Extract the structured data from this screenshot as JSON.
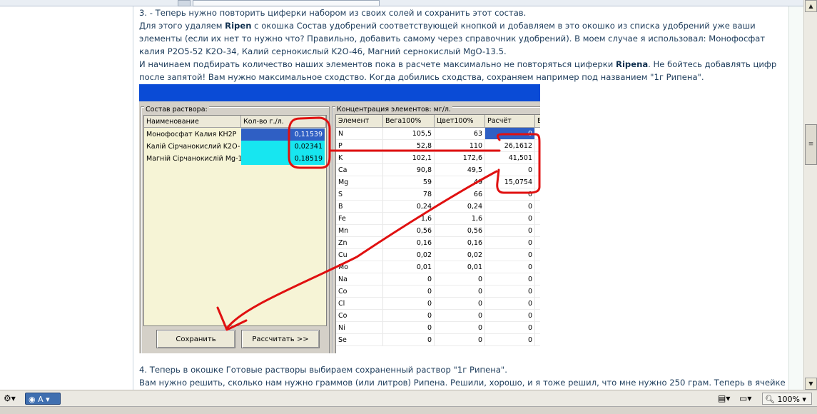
{
  "article": {
    "lines": [
      "3. - Теперь нужно повторить циферки набором из своих солей и сохранить этот состав.",
      [
        "Для этого удаляем ",
        "Ripen",
        " с окошка Состав удобрений соответствующей кнопкой и добавляем в это окошко из списка удобрений уже ваши"
      ],
      "элементы (если их нет то нужно что? Правильно, добавить самому через справочник удобрений). В моем случае я использовал: Монофосфат",
      "калия P2O5-52 K2O-34, Калий сернокислый K2O-46, Магний сернокислый MgO-13.5.",
      [
        "И начинаем подбирать количество наших элементов пока в расчете максимально не повторяться циферки ",
        "Ripena",
        ". Не бойтесь добавлять цифр"
      ],
      "после запятой! Вам нужно максимальное сходство. Когда добились сходства, сохраняем например под названием \"1г Рипена\".",
      "4. Теперь в окошке Готовые растворы выбираем сохраненный раствор \"1г Рипена\".",
      "Вам нужно решить, сколько нам нужно граммов (или литров) Рипена. Решили, хорошо, и я тоже решил, что мне нужно 250 грам. Теперь в ячейке"
    ]
  },
  "window": {
    "left_group_title": "Состав раствора:",
    "right_group_title": "Концентрация элементов: мг/л.",
    "left_headers": [
      "Наименование",
      "Кол-во г./л."
    ],
    "left_rows": [
      {
        "name": "Монофосфат Калия KH2P",
        "value": "0,11539",
        "fill": "#3d6ccb",
        "valfill": "#2f5fc4",
        "valcolor": "#ffffff"
      },
      {
        "name": "Калій Сірчанокислий K2O-",
        "value": "0,02341",
        "fill": "#17e6f0",
        "valfill": "#15c7e0",
        "valcolor": "#000000"
      },
      {
        "name": "Магній Сірчанокислій Mg-1",
        "value": "0,18519",
        "fill": "#17e6f0",
        "valfill": "#15c7e0",
        "valcolor": "#000000"
      }
    ],
    "buttons": {
      "save": "Сохранить",
      "calc": "Рассчитать >>"
    },
    "right_headers": [
      "Элемент",
      "Вега100%",
      "Цвет100%",
      "Расчёт",
      "В"
    ],
    "right_rows": [
      [
        "N",
        "105,5",
        "63",
        "0"
      ],
      [
        "P",
        "52,8",
        "110",
        "26,1612"
      ],
      [
        "K",
        "102,1",
        "172,6",
        "41,501"
      ],
      [
        "Ca",
        "90,8",
        "49,5",
        "0"
      ],
      [
        "Mg",
        "59",
        "49",
        "15,0754"
      ],
      [
        "S",
        "78",
        "66",
        "0"
      ],
      [
        "B",
        "0,24",
        "0,24",
        "0"
      ],
      [
        "Fe",
        "1,6",
        "1,6",
        "0"
      ],
      [
        "Mn",
        "0,56",
        "0,56",
        "0"
      ],
      [
        "Zn",
        "0,16",
        "0,16",
        "0"
      ],
      [
        "Cu",
        "0,02",
        "0,02",
        "0"
      ],
      [
        "Mo",
        "0,01",
        "0,01",
        "0"
      ],
      [
        "Na",
        "0",
        "0",
        "0"
      ],
      [
        "Co",
        "0",
        "0",
        "0"
      ],
      [
        "Cl",
        "0",
        "0",
        "0"
      ],
      [
        "Co",
        "0",
        "0",
        "0"
      ],
      [
        "Ni",
        "0",
        "0",
        "0"
      ],
      [
        "Se",
        "0",
        "0",
        "0"
      ]
    ]
  },
  "statusbar": {
    "left_icon": "gear-icon",
    "lang_chip": "A",
    "zoom": "100%",
    "zoom_icon": "magnifier-icon",
    "page_icon": "page-icon",
    "mode_icon": "display-mode-icon"
  },
  "colors": {
    "annotation": "#e01010",
    "link_text": "#1d3c5b",
    "window_title": "#0a4bd6"
  }
}
